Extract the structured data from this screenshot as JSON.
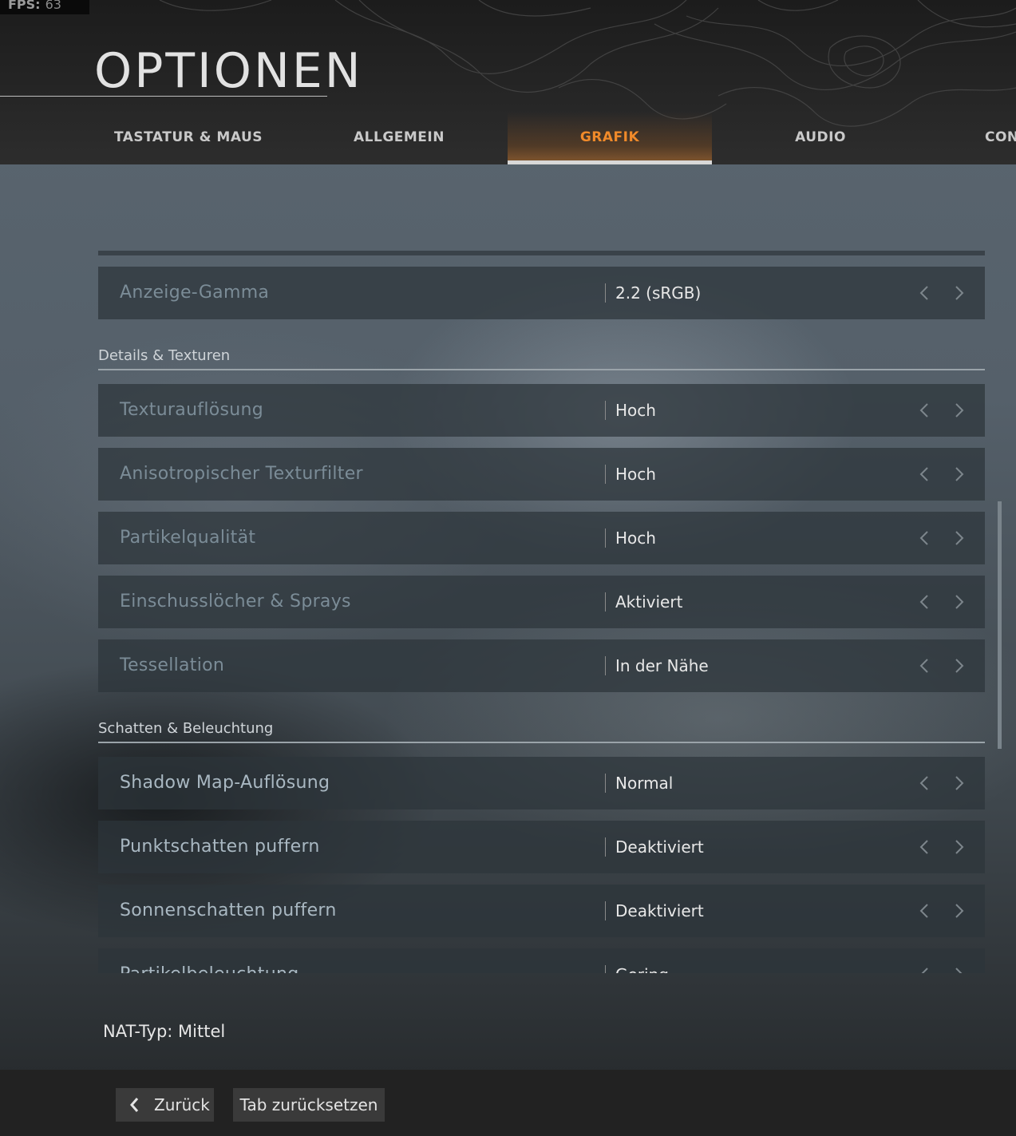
{
  "fps": {
    "label": "FPS:",
    "value": "63"
  },
  "title": "OPTIONEN",
  "tabs": [
    {
      "label": "TASTATUR & MAUS",
      "active": false
    },
    {
      "label": "ALLGEMEIN",
      "active": false
    },
    {
      "label": "GRAFIK",
      "active": true
    },
    {
      "label": "AUDIO",
      "active": false
    },
    {
      "label": "CONT",
      "active": false
    }
  ],
  "settings": {
    "rows_top": [
      {
        "label": "Anzeige-Gamma",
        "value": "2.2 (sRGB)"
      }
    ],
    "sections": [
      {
        "title": "Details & Texturen",
        "rows": [
          {
            "label": "Texturauflösung",
            "value": "Hoch"
          },
          {
            "label": "Anisotropischer Texturfilter",
            "value": "Hoch"
          },
          {
            "label": "Partikelqualität",
            "value": "Hoch"
          },
          {
            "label": "Einschusslöcher & Sprays",
            "value": "Aktiviert"
          },
          {
            "label": "Tessellation",
            "value": "In der Nähe"
          }
        ]
      },
      {
        "title": "Schatten & Beleuchtung",
        "rows": [
          {
            "label": "Shadow Map-Auflösung",
            "value": "Normal"
          },
          {
            "label": "Punktschatten puffern",
            "value": "Deaktiviert"
          },
          {
            "label": "Sonnenschatten puffern",
            "value": "Deaktiviert"
          },
          {
            "label": "Partikelbeleuchtung",
            "value": "Gering"
          }
        ]
      }
    ]
  },
  "nat": "NAT-Typ: Mittel",
  "footer": {
    "back_label": "Zurück",
    "reset_label": "Tab zurücksetzen"
  },
  "colors": {
    "accent": "#f08a2a",
    "row_bg": "#2d343a",
    "label_dim": "#7b8c97"
  }
}
